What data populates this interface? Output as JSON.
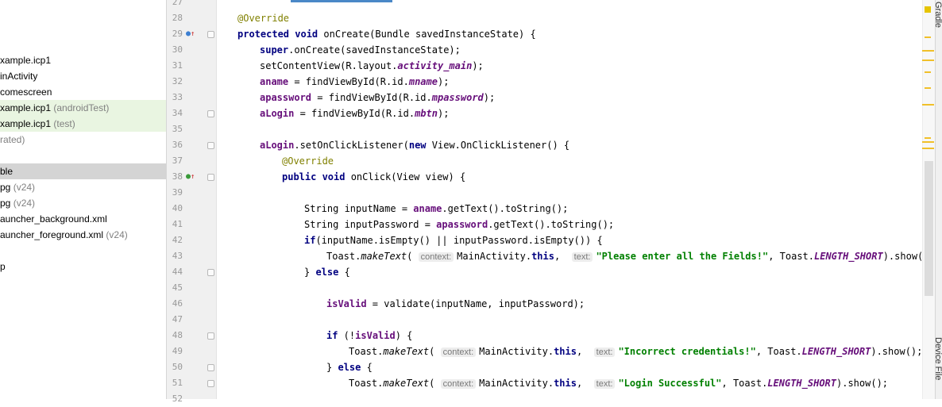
{
  "project_tree": {
    "items": [
      {
        "label": "xample.icp1",
        "hint": "",
        "style": "normal"
      },
      {
        "label": "inActivity",
        "hint": "",
        "style": "normal"
      },
      {
        "label": "comescreen",
        "hint": "",
        "style": "normal"
      },
      {
        "label": "xample.icp1",
        "hint": "(androidTest)",
        "style": "test"
      },
      {
        "label": "xample.icp1",
        "hint": "(test)",
        "style": "test"
      },
      {
        "label": "rated)",
        "hint": "",
        "style": "gray"
      },
      {
        "label": "",
        "hint": "",
        "style": "normal"
      },
      {
        "label": "ble",
        "hint": "",
        "style": "selected"
      },
      {
        "label": "pg",
        "hint": "(v24)",
        "style": "normal"
      },
      {
        "label": "pg",
        "hint": "(v24)",
        "style": "normal"
      },
      {
        "label": "auncher_background.xml",
        "hint": "",
        "style": "normal"
      },
      {
        "label": "auncher_foreground.xml",
        "hint": "(v24)",
        "style": "normal"
      },
      {
        "label": "",
        "hint": "",
        "style": "normal"
      },
      {
        "label": "p",
        "hint": "",
        "style": "normal"
      }
    ]
  },
  "editor": {
    "line_numbers": [
      "27",
      "28",
      "29",
      "30",
      "31",
      "32",
      "33",
      "34",
      "35",
      "36",
      "37",
      "38",
      "39",
      "40",
      "41",
      "42",
      "43",
      "44",
      "45",
      "46",
      "47",
      "48",
      "49",
      "50",
      "51",
      "52"
    ],
    "lines": [
      [],
      [
        {
          "t": "@Override",
          "c": "ann"
        }
      ],
      [
        {
          "t": "protected void ",
          "c": "kw"
        },
        {
          "t": "onCreate(Bundle savedInstanceState) {",
          "c": ""
        }
      ],
      [
        {
          "t": "super",
          "c": "kw"
        },
        {
          "t": ".onCreate(savedInstanceState);",
          "c": ""
        }
      ],
      [
        {
          "t": "setContentView(R.layout.",
          "c": ""
        },
        {
          "t": "activity_main",
          "c": "fldi"
        },
        {
          "t": ");",
          "c": ""
        }
      ],
      [
        {
          "t": "aname",
          "c": "fld"
        },
        {
          "t": " = findViewById(R.id.",
          "c": ""
        },
        {
          "t": "mname",
          "c": "fldi"
        },
        {
          "t": ");",
          "c": ""
        }
      ],
      [
        {
          "t": "apassword",
          "c": "fld"
        },
        {
          "t": " = findViewById(R.id.",
          "c": ""
        },
        {
          "t": "mpassword",
          "c": "fldi"
        },
        {
          "t": ");",
          "c": ""
        }
      ],
      [
        {
          "t": "aLogin",
          "c": "fld"
        },
        {
          "t": " = findViewById(R.id.",
          "c": ""
        },
        {
          "t": "mbtn",
          "c": "fldi"
        },
        {
          "t": ");",
          "c": ""
        }
      ],
      [],
      [
        {
          "t": "aLogin",
          "c": "fld"
        },
        {
          "t": ".setOnClickListener(",
          "c": ""
        },
        {
          "t": "new ",
          "c": "kw"
        },
        {
          "t": "View.OnClickListener() {",
          "c": ""
        }
      ],
      [
        {
          "t": "@Override",
          "c": "ann"
        }
      ],
      [
        {
          "t": "public void ",
          "c": "kw"
        },
        {
          "t": "onClick(View view) {",
          "c": ""
        }
      ],
      [],
      [
        {
          "t": "String inputName = ",
          "c": ""
        },
        {
          "t": "aname",
          "c": "fld"
        },
        {
          "t": ".getText().toString();",
          "c": ""
        }
      ],
      [
        {
          "t": "String inputPassword = ",
          "c": ""
        },
        {
          "t": "apassword",
          "c": "fld"
        },
        {
          "t": ".getText().toString();",
          "c": ""
        }
      ],
      [
        {
          "t": "if",
          "c": "kw"
        },
        {
          "t": "(inputName.isEmpty() || inputPassword.isEmpty()) {",
          "c": ""
        }
      ],
      [
        {
          "t": "Toast.",
          "c": ""
        },
        {
          "t": "makeText",
          "c": "sm"
        },
        {
          "t": "( ",
          "c": ""
        },
        {
          "t": "context:",
          "c": "hint"
        },
        {
          "t": "MainActivity.",
          "c": ""
        },
        {
          "t": "this",
          "c": "kw"
        },
        {
          "t": ",  ",
          "c": ""
        },
        {
          "t": "text:",
          "c": "hint"
        },
        {
          "t": "\"Please enter all the Fields!\"",
          "c": "str"
        },
        {
          "t": ", Toast.",
          "c": ""
        },
        {
          "t": "LENGTH_SHORT",
          "c": "fldi"
        },
        {
          "t": ").show();",
          "c": ""
        }
      ],
      [
        {
          "t": "} ",
          "c": ""
        },
        {
          "t": "else",
          "c": "kw"
        },
        {
          "t": " {",
          "c": ""
        }
      ],
      [],
      [
        {
          "t": "isValid",
          "c": "fld"
        },
        {
          "t": " = validate(inputName, inputPassword);",
          "c": ""
        }
      ],
      [],
      [
        {
          "t": "if",
          "c": "kw"
        },
        {
          "t": " (!",
          "c": ""
        },
        {
          "t": "isValid",
          "c": "fld"
        },
        {
          "t": ") {",
          "c": ""
        }
      ],
      [
        {
          "t": "Toast.",
          "c": ""
        },
        {
          "t": "makeText",
          "c": "sm"
        },
        {
          "t": "( ",
          "c": ""
        },
        {
          "t": "context:",
          "c": "hint"
        },
        {
          "t": "MainActivity.",
          "c": ""
        },
        {
          "t": "this",
          "c": "kw"
        },
        {
          "t": ",  ",
          "c": ""
        },
        {
          "t": "text:",
          "c": "hint"
        },
        {
          "t": "\"Incorrect credentials!\"",
          "c": "str"
        },
        {
          "t": ", Toast.",
          "c": ""
        },
        {
          "t": "LENGTH_SHORT",
          "c": "fldi"
        },
        {
          "t": ").show();",
          "c": ""
        }
      ],
      [
        {
          "t": "} ",
          "c": ""
        },
        {
          "t": "else",
          "c": "kw"
        },
        {
          "t": " {",
          "c": ""
        }
      ],
      [
        {
          "t": "Toast.",
          "c": ""
        },
        {
          "t": "makeText",
          "c": "sm"
        },
        {
          "t": "( ",
          "c": ""
        },
        {
          "t": "context:",
          "c": "hint"
        },
        {
          "t": "MainActivity.",
          "c": ""
        },
        {
          "t": "this",
          "c": "kw"
        },
        {
          "t": ",  ",
          "c": ""
        },
        {
          "t": "text:",
          "c": "hint"
        },
        {
          "t": "\"Login Successful\"",
          "c": "str"
        },
        {
          "t": ", Toast.",
          "c": ""
        },
        {
          "t": "LENGTH_SHORT",
          "c": "fldi"
        },
        {
          "t": ").show();",
          "c": ""
        }
      ],
      []
    ]
  },
  "right_panel": {
    "gradle_label": "Gradle",
    "device_label": "Device File"
  },
  "colors": {
    "annotation": "#808000",
    "keyword": "#000080",
    "field": "#660e7a",
    "string": "#008000",
    "selection": "#d4d4d4",
    "test_bg": "#e9f5e1",
    "marker": "#f0c02a"
  }
}
